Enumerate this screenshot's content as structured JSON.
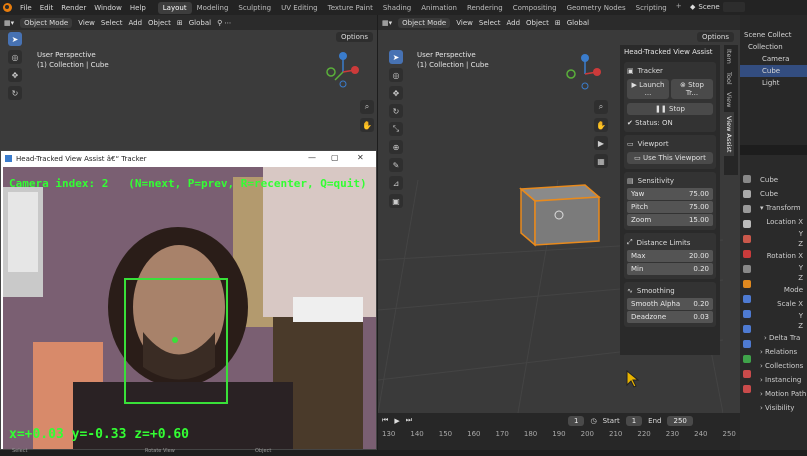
{
  "topbar": {
    "menu": [
      "File",
      "Edit",
      "Render",
      "Window",
      "Help"
    ],
    "workspaces": [
      "Layout",
      "Modeling",
      "Sculpting",
      "UV Editing",
      "Texture Paint",
      "Shading",
      "Animation",
      "Rendering",
      "Compositing",
      "Geometry Nodes",
      "Scripting"
    ],
    "add_tab": "+",
    "scene_label": "Scene"
  },
  "left_viewport": {
    "mode": "Object Mode",
    "menus": [
      "View",
      "Select",
      "Add",
      "Object"
    ],
    "orientation": "Global",
    "perspective": "User Perspective",
    "collection": "(1) Collection | Cube",
    "options": "Options"
  },
  "right_viewport": {
    "mode": "Object Mode",
    "menus": [
      "View",
      "Select",
      "Add",
      "Object"
    ],
    "orientation": "Global",
    "perspective": "User Perspective",
    "collection": "(1) Collection | Cube",
    "options": "Options"
  },
  "npanel": {
    "title": "Head-Tracked View Assist",
    "tracker": {
      "label": "Tracker",
      "launch": "Launch ...",
      "stop_tracker": "Stop Tr...",
      "stop": "Stop",
      "status": "Status: ON"
    },
    "viewport": {
      "label": "Viewport",
      "use_view": "Use This Viewport"
    },
    "sensitivity": {
      "label": "Sensitivity",
      "rows": [
        [
          "Yaw",
          "75.00"
        ],
        [
          "Pitch",
          "75.00"
        ],
        [
          "Zoom",
          "15.00"
        ]
      ]
    },
    "distance": {
      "label": "Distance Limits",
      "rows": [
        [
          "Max",
          "20.00"
        ],
        [
          "Min",
          "0.20"
        ]
      ]
    },
    "smoothing": {
      "label": "Smoothing",
      "rows": [
        [
          "Smooth Alpha",
          "0.20"
        ],
        [
          "Deadzone",
          "0.03"
        ]
      ]
    },
    "vtabs": [
      "Item",
      "Tool",
      "View",
      "View Assist"
    ]
  },
  "outliner": {
    "items": [
      "Scene Collect",
      "Collection",
      "Camera",
      "Cube",
      "Light"
    ]
  },
  "properties": {
    "object_name": "Cube",
    "data_name": "Cube",
    "transform": "Transform",
    "rows_left": [
      "Location X",
      "Y",
      "Z",
      "Rotation X",
      "Y",
      "Z",
      "Mode",
      "Scale X",
      "Y",
      "Z"
    ],
    "collapsed": [
      "Delta Tra",
      "Relations",
      "Collections",
      "Instancing",
      "Motion Path",
      "Visibility"
    ]
  },
  "timeline": {
    "frame": "1",
    "start_label": "Start",
    "start": "1",
    "end_label": "End",
    "end": "250",
    "ruler": [
      "130",
      "140",
      "150",
      "160",
      "170",
      "180",
      "190",
      "200",
      "210",
      "220",
      "230",
      "240",
      "250"
    ]
  },
  "camera_window": {
    "title": "Head-Tracked View Assist â€“ Tracker",
    "minimize": "—",
    "maximize": "▢",
    "close": "✕",
    "camera_index_text": "Camera index: 2   (N=next, P=prev, R=recenter, Q=quit)",
    "coords_text": "x=+0.03 y=-0.33 z=+0.60"
  },
  "status_bar": {
    "items": [
      "Select",
      "Rotate View",
      "Object"
    ]
  }
}
